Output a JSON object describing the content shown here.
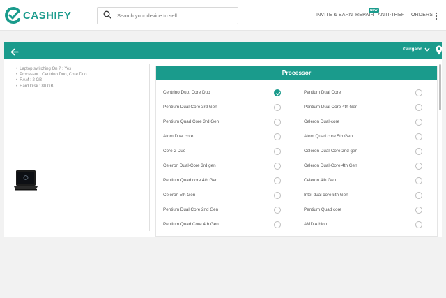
{
  "brand": {
    "name": "CASHIFY",
    "color": "#1a9b8c"
  },
  "search": {
    "placeholder": "Search your device to sell"
  },
  "nav": {
    "invite_earn": "INVITE & EARN",
    "repair": "REPAIR",
    "repair_badge": "NEW",
    "anti_theft": "ANTI-THEFT",
    "orders": "ORDERS"
  },
  "header_bar": {
    "city": "Gurgaon"
  },
  "device_specs": [
    "Laptop switching On ? : Yes",
    "Processor : Centrino Duo, Core Duo",
    "RAM : 2 GB",
    "Hard Disk : 80 GB"
  ],
  "question": {
    "title": "Processor",
    "left_options": [
      {
        "label": "Centrino Duo, Core Duo",
        "selected": true
      },
      {
        "label": "Pentium Dual Core 3rd Gen",
        "selected": false
      },
      {
        "label": "Pentium Quad Core 3rd Gen",
        "selected": false
      },
      {
        "label": "Atom Dual core",
        "selected": false
      },
      {
        "label": "Core 2 Duo",
        "selected": false
      },
      {
        "label": "Celeron Dual-Core 3rd gen",
        "selected": false
      },
      {
        "label": "Pentium Quad core 4th Gen",
        "selected": false
      },
      {
        "label": "Celeron 5th Gen",
        "selected": false
      },
      {
        "label": "Pentium Dual Core 2nd Gen",
        "selected": false
      },
      {
        "label": "Pentium Quad Core 4th Gen",
        "selected": false
      }
    ],
    "right_options": [
      {
        "label": "Pentium Dual Core",
        "selected": false
      },
      {
        "label": "Pentium Dual Core 4th Gen",
        "selected": false
      },
      {
        "label": "Celeron Dual-core",
        "selected": false
      },
      {
        "label": "Atom Quad core 5th Gen",
        "selected": false
      },
      {
        "label": "Celeron Dual-Core 2nd gen",
        "selected": false
      },
      {
        "label": "Celeron Dual-Core 4th Gen",
        "selected": false
      },
      {
        "label": "Celeron 4th Gen",
        "selected": false
      },
      {
        "label": "Intel dual core 5th Gen",
        "selected": false
      },
      {
        "label": "Pentium Quad core",
        "selected": false
      },
      {
        "label": "AMD Athlon",
        "selected": false
      }
    ]
  }
}
